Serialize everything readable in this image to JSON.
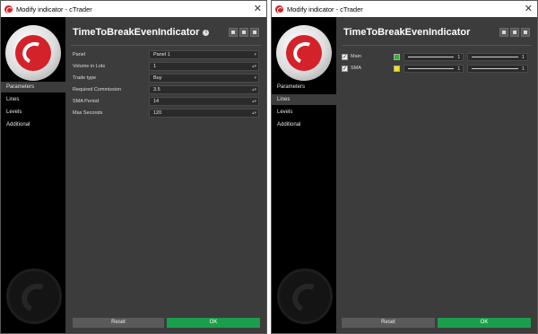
{
  "left_window": {
    "title": "Modify indicator - cTrader",
    "close": "✕",
    "nav": [
      {
        "label": "Parameters"
      },
      {
        "label": "Lines"
      },
      {
        "label": "Levels"
      },
      {
        "label": "Additional"
      }
    ],
    "indicator_title": "TimeToBreakEvenIndicator",
    "info_glyph": "i",
    "params": [
      {
        "label": "Panel",
        "value": "Panel 1",
        "arrow": "▾"
      },
      {
        "label": "Volume in Lots",
        "value": "1",
        "arrow": "▴▾"
      },
      {
        "label": "Trade type",
        "value": "Buy",
        "arrow": "▾"
      },
      {
        "label": "Required Commission",
        "value": "3.5",
        "arrow": "▴▾"
      },
      {
        "label": "SMA Period",
        "value": "14",
        "arrow": "▴▾"
      },
      {
        "label": "Max Seconds",
        "value": "120",
        "arrow": "▴▾"
      }
    ],
    "reset_label": "Reset",
    "ok_label": "OK"
  },
  "right_window": {
    "title": "Modify indicator - cTrader",
    "close": "✕",
    "nav": [
      {
        "label": "Parameters"
      },
      {
        "label": "Lines"
      },
      {
        "label": "Levels"
      },
      {
        "label": "Additional"
      }
    ],
    "indicator_title": "TimeToBreakEvenIndicator",
    "lines": [
      {
        "label": "Main",
        "checked": "✓",
        "color": "#2fb52f",
        "thickness": "1",
        "style": "1"
      },
      {
        "label": "SMA",
        "checked": "✓",
        "color": "#f5e300",
        "thickness": "1",
        "style": "1"
      }
    ],
    "reset_label": "Reset",
    "ok_label": "OK"
  },
  "colors": {
    "accent_green": "#1a9e4b",
    "brand_red": "#d3222a",
    "panel_bg": "#3c3c3c",
    "sidebar_bg": "#000000"
  }
}
